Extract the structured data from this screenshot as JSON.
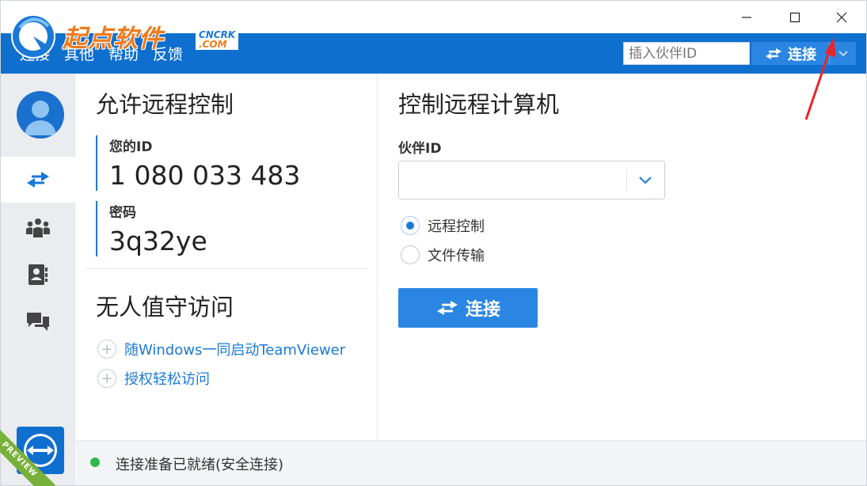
{
  "window": {
    "controls": {
      "minimize": "—",
      "maximize": "☐",
      "close": "✕"
    }
  },
  "watermark": {
    "brand_text": "起点软件",
    "badge_top": "CNCRK",
    "badge_bottom": ".COM"
  },
  "menubar": {
    "items": [
      "连接",
      "其他",
      "帮助",
      "反馈"
    ],
    "partner_placeholder": "插入伙伴ID",
    "connect_label": "连接"
  },
  "sidebar": {
    "preview_label": "PREVIEW"
  },
  "allow_remote": {
    "title": "允许远程控制",
    "your_id_label": "您的ID",
    "your_id_value": "1 080 033 483",
    "password_label": "密码",
    "password_value": "3q32ye"
  },
  "unattended": {
    "title": "无人值守访问",
    "links": [
      "随Windows一同启动TeamViewer",
      "授权轻松访问"
    ]
  },
  "control_remote": {
    "title": "控制远程计算机",
    "partner_id_label": "伙伴ID",
    "partner_id_value": "",
    "options": [
      {
        "label": "远程控制",
        "checked": true
      },
      {
        "label": "文件传输",
        "checked": false
      }
    ],
    "connect_label": "连接"
  },
  "status": {
    "text": "连接准备已就绪(安全连接)",
    "color": "#2fb94a"
  },
  "colors": {
    "brand_blue": "#0e6fcf",
    "button_blue": "#2b86e3",
    "link_blue": "#1a79d8"
  }
}
